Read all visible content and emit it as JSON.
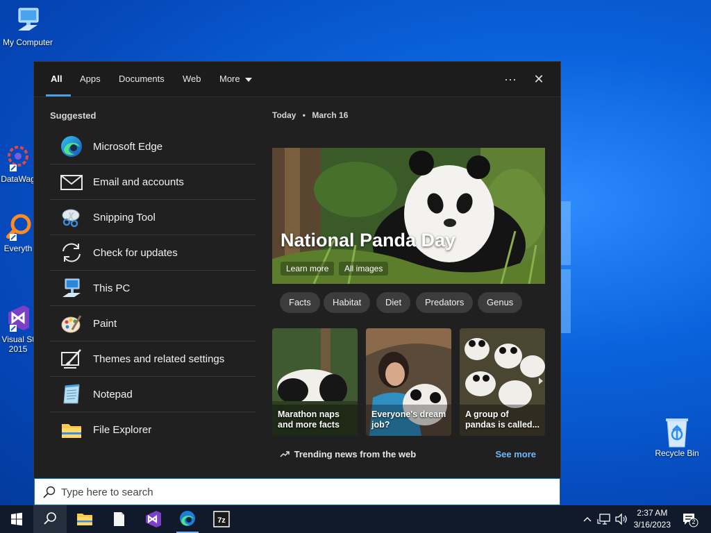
{
  "desktop": {
    "icons": [
      {
        "label": "My Computer"
      },
      {
        "label": "DataWag"
      },
      {
        "label": "Everyth"
      },
      {
        "label": "Visual St\n2015"
      },
      {
        "label": "Recycle Bin"
      }
    ]
  },
  "search_panel": {
    "tabs": [
      {
        "label": "All"
      },
      {
        "label": "Apps"
      },
      {
        "label": "Documents"
      },
      {
        "label": "Web"
      },
      {
        "label": "More"
      }
    ],
    "more_options": "···",
    "close": "✕",
    "suggested": {
      "title": "Suggested",
      "items": [
        {
          "label": "Microsoft Edge",
          "icon": "edge-icon"
        },
        {
          "label": "Email and accounts",
          "icon": "mail-icon"
        },
        {
          "label": "Snipping Tool",
          "icon": "snipping-tool-icon"
        },
        {
          "label": "Check for updates",
          "icon": "refresh-icon"
        },
        {
          "label": "This PC",
          "icon": "computer-icon"
        },
        {
          "label": "Paint",
          "icon": "paint-icon"
        },
        {
          "label": "Themes and related settings",
          "icon": "themes-icon"
        },
        {
          "label": "Notepad",
          "icon": "notepad-icon"
        },
        {
          "label": "File Explorer",
          "icon": "folder-icon"
        }
      ]
    },
    "today": {
      "prefix": "Today",
      "dot": "•",
      "date": "March 16"
    },
    "hero": {
      "title": "National Panda Day",
      "learn_more": "Learn more",
      "all_images": "All images"
    },
    "chips": [
      "Facts",
      "Habitat",
      "Diet",
      "Predators",
      "Genus"
    ],
    "cards": [
      {
        "caption": "Marathon naps and more facts"
      },
      {
        "caption": "Everyone's dream job?"
      },
      {
        "caption": "A group of pandas is called..."
      }
    ],
    "trending": {
      "label": "Trending news from the web",
      "see_more": "See more"
    }
  },
  "search_box": {
    "placeholder": "Type here to search"
  },
  "taskbar": {
    "apps": [
      "start-icon",
      "search-icon",
      "file-explorer-icon",
      "notepad-icon",
      "visual-studio-icon",
      "edge-icon",
      "7zip-icon"
    ],
    "clock_time": "2:37 AM",
    "clock_date": "3/16/2023",
    "notification_count": "2",
    "tray_up": "⌃"
  },
  "colors": {
    "accent": "#0078d4",
    "panel_bg": "#202020",
    "link": "#6fb8ff"
  }
}
